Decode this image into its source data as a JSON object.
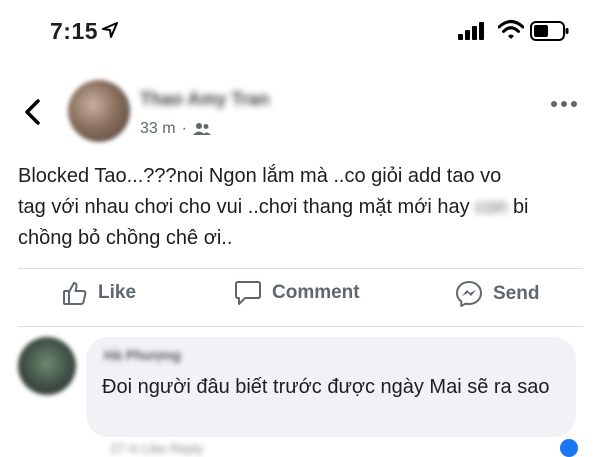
{
  "status_bar": {
    "time": "7:15"
  },
  "post": {
    "author_name": "Thao Amy Tran",
    "time_ago": "33 m",
    "text_lines": [
      "Blocked Tao...???noi Ngon lắm mà ..co giỏi add tao vo",
      "tag với nhau chơi cho vui ..chơi thang mặt mới hay",
      "bi",
      "chồng bỏ chồng chê ơi.."
    ],
    "blurred_word": "con"
  },
  "actions": {
    "like": "Like",
    "comment": "Comment",
    "send": "Send"
  },
  "comment": {
    "author_name": "Hà Phượng",
    "text": "Đoi người đâu biết trước  được  ngày Mai sẽ ra sao",
    "footer": "27 m   Like   Reply"
  },
  "colors": {
    "accent": "#1877f2",
    "bubble": "#f0f2f5",
    "muted": "#606770"
  },
  "icons": {
    "location": "location-arrow-icon",
    "signal": "signal-icon",
    "wifi": "wifi-icon",
    "battery": "battery-icon",
    "back": "back-chevron-icon",
    "friends": "friends-icon",
    "more": "more-dots-icon",
    "like": "thumbs-up-icon",
    "comment": "comment-icon",
    "send": "messenger-icon"
  }
}
